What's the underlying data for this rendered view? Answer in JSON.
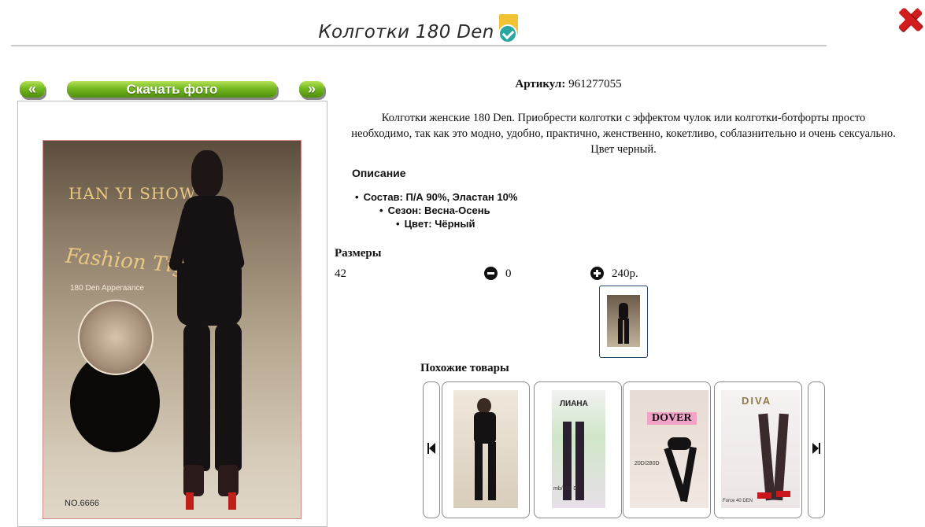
{
  "header": {
    "title": "Колготки 180 Den"
  },
  "photo_nav": {
    "prev_label": "«",
    "download_label": "Скачать фото",
    "next_label": "»"
  },
  "photo": {
    "brand": "HAN YI SHOW",
    "script_text": "Fashion  Tights",
    "appearance": "180 Den Apperaance",
    "model_number": "NO.6666"
  },
  "product": {
    "article_label": "Артикул:",
    "article_value": "961277055",
    "description": "Колготки женские 180 Den. Приобрести колготки с эффектом чулок или колготки-ботфорты просто необходимо, так как это модно, удобно, практично, женственно, кокетливо, соблазнительно и очень сексуально. Цвет черный.",
    "specs_title": "Описание",
    "specs": [
      "Состав: П/А 90%, Эластан 10%",
      "Сезон: Весна-Осень",
      "Цвет: Чёрный"
    ]
  },
  "sizes": {
    "title": "Размеры",
    "rows": [
      {
        "size": "42",
        "quantity": "0",
        "price": "240р."
      }
    ]
  },
  "similar": {
    "title": "Похожие товары",
    "items": [
      {
        "caption": ""
      },
      {
        "caption": "ЛИАНА",
        "sub": "mb/300 D"
      },
      {
        "caption": "DOVER",
        "sub": "20D/280D"
      },
      {
        "caption": "DIVA",
        "sub": "Force 40 DEN"
      }
    ]
  },
  "colors": {
    "accent_green": "#74b820",
    "close_red": "#d21d1d",
    "verified_teal": "#2aa6a0",
    "verified_gold": "#f2c233"
  },
  "icons": [
    "verified-check-icon",
    "close-icon",
    "minus-circle-icon",
    "plus-circle-icon",
    "skip-back-icon",
    "skip-forward-icon"
  ]
}
